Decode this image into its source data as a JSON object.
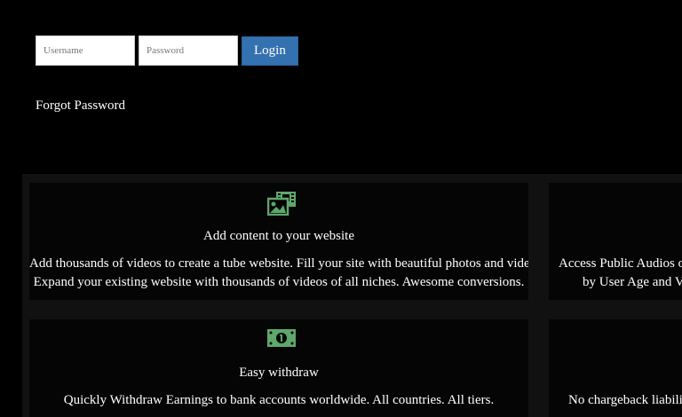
{
  "login": {
    "username_placeholder": "Username",
    "password_placeholder": "Password",
    "login_label": "Login",
    "forgot_label": "Forgot Password"
  },
  "features": [
    {
      "icon": "images-icon",
      "title": "Add content to your website",
      "desc_line1": "Add thousands of videos to create a tube website. Fill your site with beautiful photos and videos.",
      "desc_line2": "Expand your existing website with thousands of videos of all niches. Awesome conversions."
    },
    {
      "icon": "",
      "title": "",
      "desc_line1": "Access Public Audios of",
      "desc_line2": "by User Age and Vi"
    },
    {
      "icon": "money-icon",
      "title": "Easy withdraw",
      "desc_line1": "Quickly Withdraw Earnings to bank accounts worldwide. All countries. All tiers.",
      "desc_line2": ""
    },
    {
      "icon": "",
      "title": "",
      "desc_line1": "No chargeback liability",
      "desc_line2": ""
    }
  ],
  "colors": {
    "accent_green": "#5fa76b",
    "login_blue": "#3471b0",
    "grid_bg": "#111111",
    "card_bg": "#050505"
  }
}
